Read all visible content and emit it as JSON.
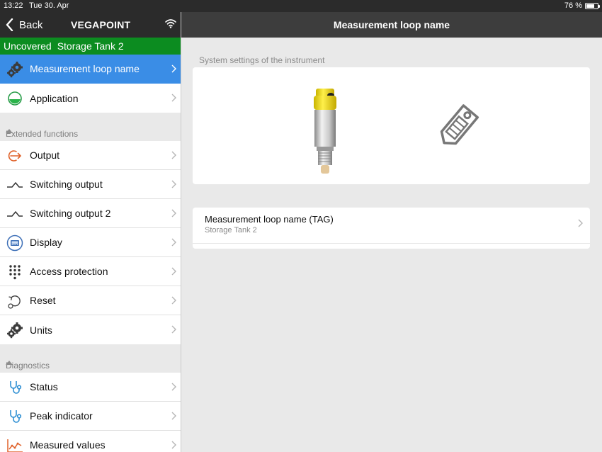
{
  "statusbar": {
    "time": "13:22",
    "date": "Tue 30. Apr",
    "battery_pct": "76 %",
    "battery_level": 0.76
  },
  "nav": {
    "back_label": "Back",
    "device_name": "VEGAPOINT",
    "title": "Measurement loop name"
  },
  "device_status": {
    "status": "Uncovered",
    "tag": "Storage Tank 2"
  },
  "menu_top": [
    {
      "label": "Measurement loop name",
      "icon": "gears-icon",
      "selected": true
    },
    {
      "label": "Application",
      "icon": "application-icon",
      "selected": false
    }
  ],
  "sections": {
    "extended": {
      "title": "Extended functions",
      "items": [
        {
          "label": "Output",
          "icon": "output-icon"
        },
        {
          "label": "Switching output",
          "icon": "switching-output-icon"
        },
        {
          "label": "Switching output 2",
          "icon": "switching-output-icon"
        },
        {
          "label": "Display",
          "icon": "display-icon"
        },
        {
          "label": "Access protection",
          "icon": "keypad-icon"
        },
        {
          "label": "Reset",
          "icon": "reset-icon"
        },
        {
          "label": "Units",
          "icon": "gear-icon"
        }
      ]
    },
    "diagnostics": {
      "title": "Diagnostics",
      "items": [
        {
          "label": "Status",
          "icon": "stethoscope-icon"
        },
        {
          "label": "Peak indicator",
          "icon": "stethoscope-icon"
        },
        {
          "label": "Measured values",
          "icon": "chart-icon"
        }
      ]
    }
  },
  "main": {
    "caption": "System settings of the instrument",
    "tag_row": {
      "title": "Measurement loop name (TAG)",
      "value": "Storage Tank 2"
    }
  },
  "colors": {
    "nav_dark": "#2b2b2b",
    "selected": "#3a8de6",
    "status_green": "#0c8c20",
    "output_orange": "#e0622a",
    "diag_blue": "#2e8fd3"
  }
}
